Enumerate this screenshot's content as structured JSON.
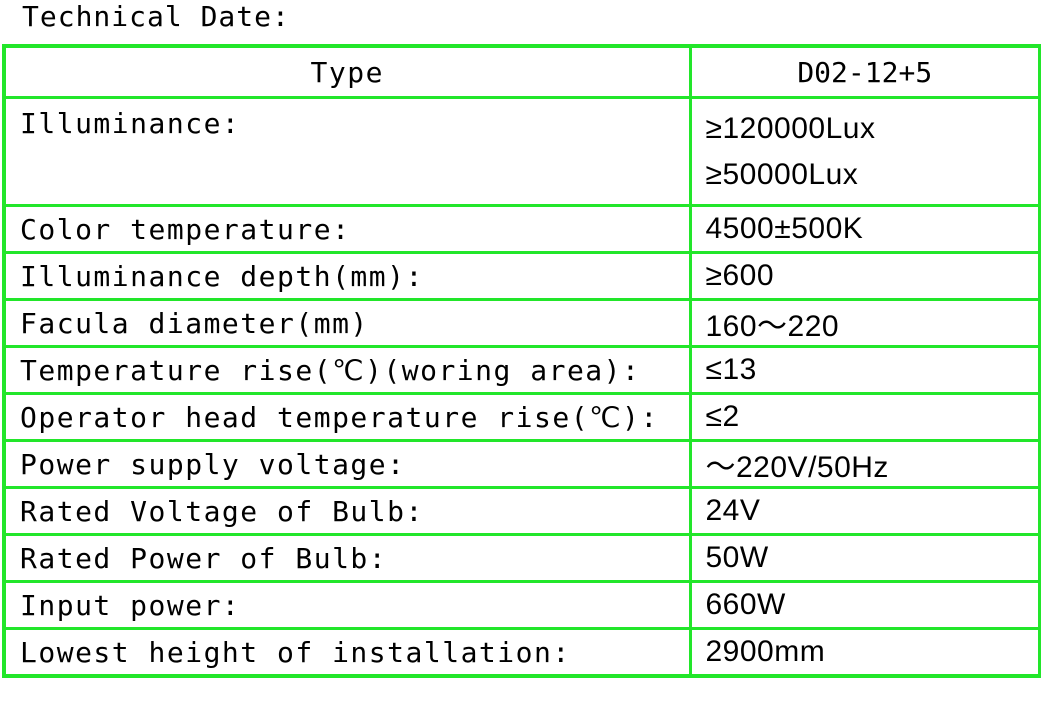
{
  "heading": "Technical Date:",
  "table": {
    "header": {
      "label": "Type",
      "value": "D02-12+5"
    },
    "illuminance": {
      "label": "Illuminance:",
      "value_1": "≥120000Lux",
      "value_2": "≥50000Lux"
    },
    "rows": [
      {
        "label": "Color temperature:",
        "value": "4500±500K"
      },
      {
        "label": "Illuminance depth(mm):",
        "value": "≥600"
      },
      {
        "label": "Facula diameter(mm)",
        "value": "160～220"
      },
      {
        "label": "Temperature rise(℃)(woring area):",
        "value": "≤13"
      },
      {
        "label": "Operator head temperature rise(℃):",
        "value": "≤2"
      },
      {
        "label": "Power supply voltage:",
        "value": "～220V/50Hz"
      },
      {
        "label": "Rated Voltage of Bulb:",
        "value": "24V"
      },
      {
        "label": "Rated Power of Bulb:",
        "value": "50W"
      },
      {
        "label": "Input power:",
        "value": "660W"
      },
      {
        "label": "Lowest height of installation:",
        "value": "2900mm"
      }
    ]
  },
  "colors": {
    "border": "#22e62a",
    "text": "#000000",
    "background": "#ffffff"
  }
}
